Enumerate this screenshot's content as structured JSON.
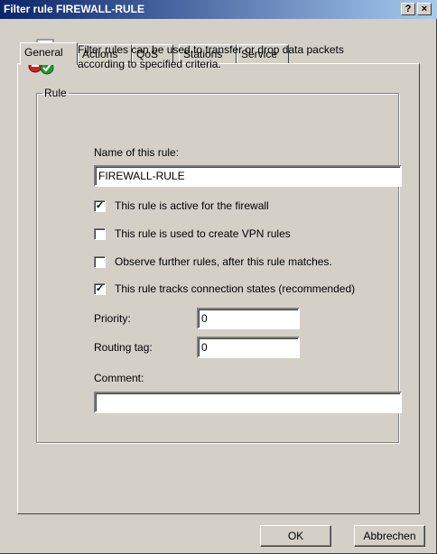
{
  "window": {
    "title": "Filter rule FIREWALL-RULE",
    "help_label": "?",
    "close_label": "×"
  },
  "tabs": [
    {
      "label": "General",
      "active": true
    },
    {
      "label": "Actions",
      "active": false
    },
    {
      "label": "QoS",
      "active": false
    },
    {
      "label": "Stations",
      "active": false
    },
    {
      "label": "Service",
      "active": false
    }
  ],
  "rule_group": {
    "legend": "Rule",
    "description": "Filter rules can be used to transfer or drop data packets according to specified criteria.",
    "name_label": "Name of this rule:",
    "name_value": "FIREWALL-RULE",
    "checkboxes": [
      {
        "label": "This rule is active for the firewall",
        "checked": true,
        "mark": "✓"
      },
      {
        "label": "This rule is used to create VPN rules",
        "checked": false,
        "mark": ""
      },
      {
        "label": "Observe further rules, after this rule matches.",
        "checked": false,
        "mark": ""
      },
      {
        "label": "This rule tracks connection states (recommended)",
        "checked": true,
        "mark": "✓"
      }
    ],
    "priority_label": "Priority:",
    "priority_value": "0",
    "routing_tag_label": "Routing tag:",
    "routing_tag_value": "0",
    "comment_label": "Comment:",
    "comment_value": ""
  },
  "buttons": {
    "ok": "OK",
    "cancel": "Abbrechen"
  },
  "icons": {
    "rule": "document-rule-icon"
  }
}
